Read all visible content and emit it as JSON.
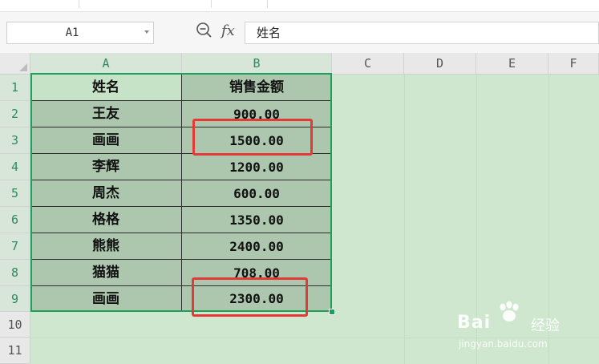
{
  "name_box": {
    "value": "A1"
  },
  "formula_bar": {
    "fx_label": "fx",
    "value": "姓名"
  },
  "columns": [
    "A",
    "B",
    "C",
    "D",
    "E",
    "F"
  ],
  "rows": [
    "1",
    "2",
    "3",
    "4",
    "5",
    "6",
    "7",
    "8",
    "9",
    "10",
    "11"
  ],
  "table": {
    "headers": [
      "姓名",
      "销售金额"
    ],
    "rows": [
      [
        "王友",
        "900.00"
      ],
      [
        "画画",
        "1500.00"
      ],
      [
        "李辉",
        "1200.00"
      ],
      [
        "周杰",
        "600.00"
      ],
      [
        "格格",
        "1350.00"
      ],
      [
        "熊熊",
        "2400.00"
      ],
      [
        "猫猫",
        "708.00"
      ],
      [
        "画画",
        "2300.00"
      ]
    ]
  },
  "watermark": {
    "brand": "Bai",
    "brand_suffix": "经验",
    "url": "jingyan.baidu.com"
  },
  "colors": {
    "selection": "#1fa05a",
    "highlight": "#e53935",
    "sheet_bg": "#cfe6cf",
    "cell_bg": "#adc7ae"
  }
}
